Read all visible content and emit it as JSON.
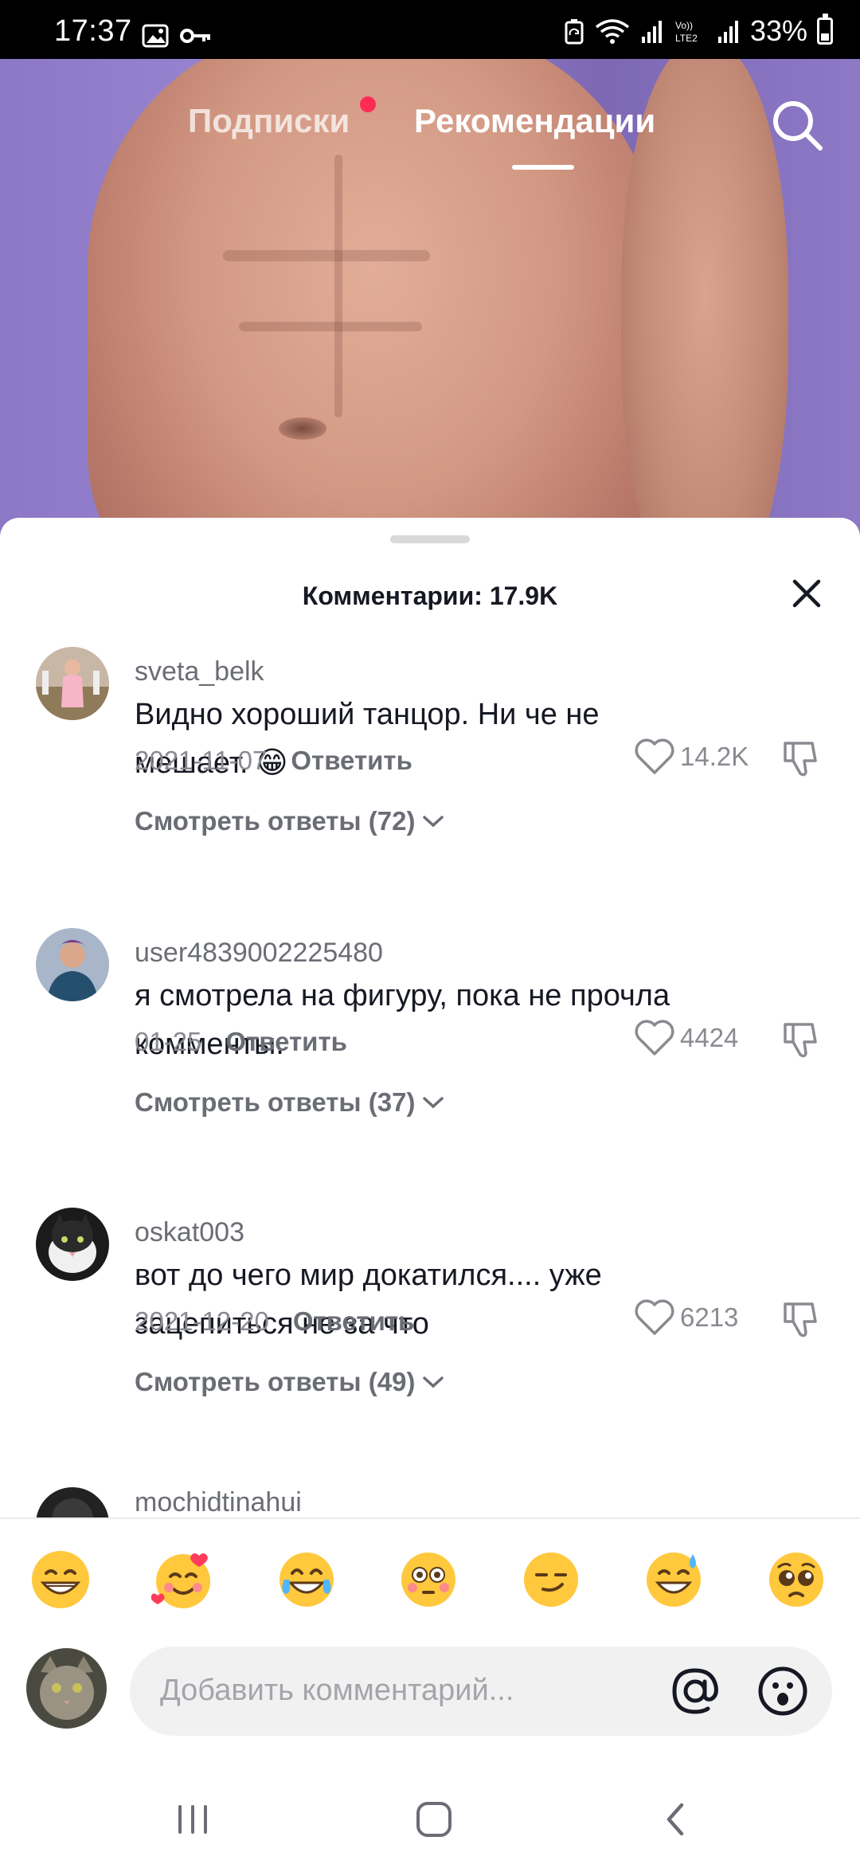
{
  "status": {
    "time": "17:37",
    "battery_percent": "33%",
    "battery_level": 0.33
  },
  "tabs": {
    "following": "Подписки",
    "for_you": "Рекомендации"
  },
  "comments_sheet": {
    "title": "Комментарии: 17.9K",
    "comments": [
      {
        "username": "sveta_belk",
        "text": "Видно хороший танцор. Ни че не мешает. 😁",
        "date": "2021-11-07",
        "reply_label": "Ответить",
        "likes": "14.2K",
        "view_replies": "Смотреть ответы (72)"
      },
      {
        "username": "user4839002225480",
        "text": "я смотрела на фигуру, пока не прочла комменты.",
        "date": "01-25",
        "reply_label": "Ответить",
        "likes": "4424",
        "view_replies": "Смотреть ответы (37)"
      },
      {
        "username": "oskat003",
        "text": "вот до чего мир докатился.... уже зацепиться не за что",
        "date": "2021-12-20",
        "reply_label": "Ответить",
        "likes": "6213",
        "view_replies": "Смотреть ответы (49)"
      },
      {
        "username": "mochidtinahui"
      }
    ],
    "quick_emojis": [
      "😁",
      "🥰",
      "😂",
      "😳",
      "😏",
      "😅",
      "🥺"
    ],
    "input_placeholder": "Добавить комментарий..."
  },
  "icons": {
    "search": "search-icon",
    "close": "close-icon",
    "like": "heart-icon",
    "dislike": "dislike-icon",
    "mention": "at-icon",
    "emoji": "emoji-icon",
    "nav_recent": "recent-apps-icon",
    "nav_home": "home-icon",
    "nav_back": "back-icon"
  },
  "colors": {
    "accent_dot": "#fe2c55",
    "text_primary": "#161823",
    "text_secondary": "#8a8b91"
  }
}
